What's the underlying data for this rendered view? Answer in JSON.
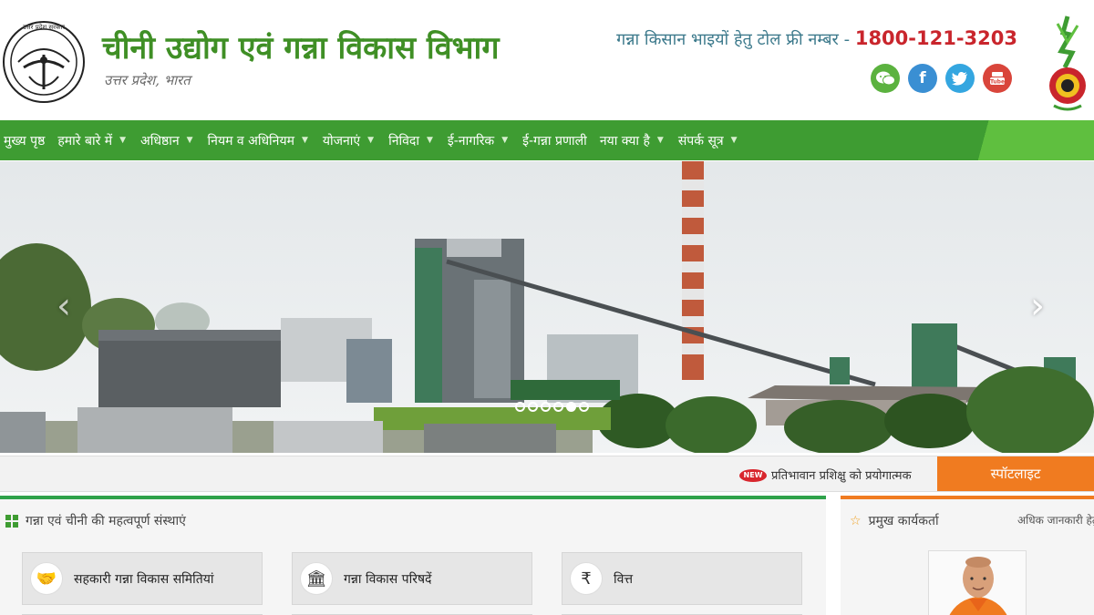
{
  "header": {
    "title": "चीनी उद्योग एवं गन्ना विकास विभाग",
    "subtitle": "उत्तर प्रदेश, भारत",
    "helpline_label": "गन्ना किसान भाइयों हेतु टोल फ्री नम्बर - ",
    "helpline_number": "1800-121-3203",
    "emblem_text": "उत्तर प्रदेश सरकार"
  },
  "socials": [
    {
      "name": "wechat-icon",
      "glyph": "✉"
    },
    {
      "name": "facebook-icon",
      "glyph": "f"
    },
    {
      "name": "twitter-icon",
      "glyph": "t"
    },
    {
      "name": "youtube-icon",
      "glyph": "▶"
    }
  ],
  "nav": {
    "items": [
      {
        "label": "मुख्य पृष्ठ",
        "dropdown": false
      },
      {
        "label": "हमारे बारे में",
        "dropdown": true
      },
      {
        "label": "अधिष्ठान",
        "dropdown": true
      },
      {
        "label": "नियम व अधिनियम",
        "dropdown": true
      },
      {
        "label": "योजनाएं",
        "dropdown": true
      },
      {
        "label": "निविदा",
        "dropdown": true
      },
      {
        "label": "ई-नागरिक",
        "dropdown": true
      },
      {
        "label": "ई-गन्ना प्रणाली",
        "dropdown": false
      },
      {
        "label": "नया क्या है",
        "dropdown": true
      },
      {
        "label": "संपर्क सूत्र",
        "dropdown": true
      }
    ]
  },
  "slider": {
    "prev": "‹",
    "next": "›",
    "dot_count": 6,
    "active_dot": 5
  },
  "ticker": {
    "new_badge": "NEW",
    "text": "प्रतिभावान प्रशिक्षु को प्रयोगात्मक",
    "spotlight": "स्पॉटलाइट"
  },
  "main_panel": {
    "title": "गन्ना एवं चीनी की महत्वपूर्ण संस्थाएं",
    "cards": [
      {
        "label": "सहकारी गन्ना विकास समितियां",
        "icon": "handshake-icon",
        "glyph": "🤝"
      },
      {
        "label": "गन्ना विकास परिषदें",
        "icon": "institution-icon",
        "glyph": "🏛"
      },
      {
        "label": "वित्त",
        "icon": "rupee-icon",
        "glyph": "₹"
      }
    ]
  },
  "side_panel": {
    "title": "प्रमुख कार्यकर्ता",
    "more": "अधिक जानकारी हेतु"
  },
  "colors": {
    "brand_green": "#3e9c32",
    "title_green": "#3f8f25",
    "helpline_red": "#c9252c",
    "spotlight_orange": "#f07b20"
  }
}
